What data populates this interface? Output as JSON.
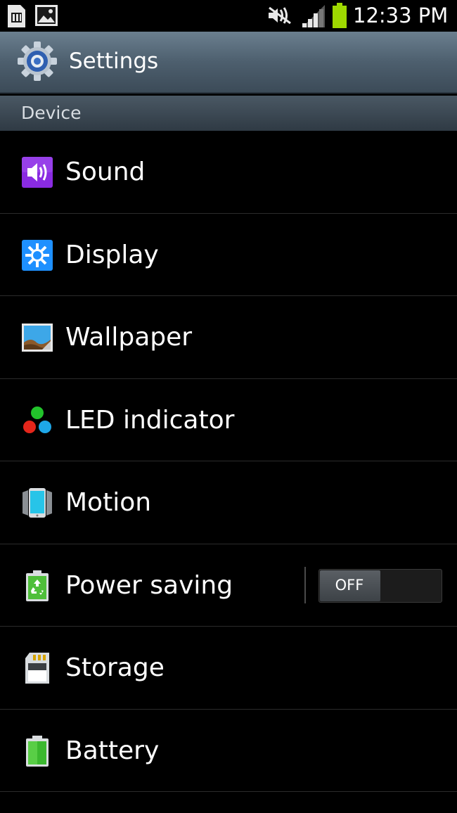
{
  "status_bar": {
    "left_icons": [
      "sim-card-icon",
      "gallery-icon"
    ],
    "right_icons": [
      "mute-icon",
      "signal-icon",
      "battery-icon"
    ],
    "time": "12:33 PM"
  },
  "action_bar": {
    "icon": "settings-gear-icon",
    "title": "Settings"
  },
  "section": {
    "title": "Device"
  },
  "items": [
    {
      "label": "Sound",
      "icon": "sound-icon"
    },
    {
      "label": "Display",
      "icon": "display-icon"
    },
    {
      "label": "Wallpaper",
      "icon": "wallpaper-icon"
    },
    {
      "label": "LED indicator",
      "icon": "led-indicator-icon"
    },
    {
      "label": "Motion",
      "icon": "motion-icon"
    },
    {
      "label": "Power saving",
      "icon": "power-saving-icon",
      "toggle": "OFF"
    },
    {
      "label": "Storage",
      "icon": "storage-icon"
    },
    {
      "label": "Battery",
      "icon": "battery-icon"
    }
  ],
  "colors": {
    "background": "#000000",
    "action_bar": "#4d5f6e",
    "section_header": "#3a4752",
    "divider": "#2b2b2b",
    "battery_green": "#9ed800",
    "sound_purple": "#8a2be2",
    "display_blue": "#1e90ff"
  }
}
